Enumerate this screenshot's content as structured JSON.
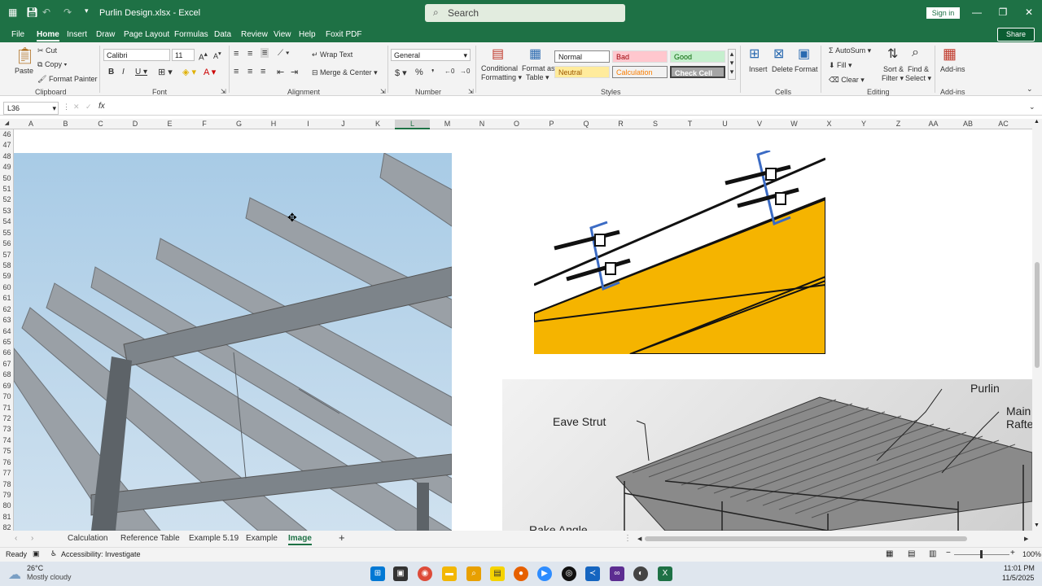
{
  "app": {
    "file_name": "Purlin Design.xlsx  -  Excel",
    "search_placeholder": "Search",
    "sign_in": "Sign in"
  },
  "menu": {
    "tabs": [
      "File",
      "Home",
      "Insert",
      "Draw",
      "Page Layout",
      "Formulas",
      "Data",
      "Review",
      "View",
      "Help",
      "Foxit PDF"
    ],
    "share": "Share"
  },
  "ribbon": {
    "clipboard": {
      "paste": "Paste",
      "cut": "Cut",
      "copy": "Copy",
      "format_painter": "Format Painter",
      "label": "Clipboard"
    },
    "font": {
      "name": "Calibri",
      "size": "11",
      "label": "Font"
    },
    "alignment": {
      "wrap_text": "Wrap Text",
      "merge_center": "Merge & Center",
      "label": "Alignment"
    },
    "number": {
      "format": "General",
      "label": "Number"
    },
    "styles": {
      "conditional": "Conditional",
      "conditional2": "Formatting",
      "format_as": "Format as",
      "format_as2": "Table",
      "normal": "Normal",
      "bad": "Bad",
      "good": "Good",
      "neutral": "Neutral",
      "calculation": "Calculation",
      "check_cell": "Check Cell",
      "label": "Styles"
    },
    "cells": {
      "insert": "Insert",
      "delete": "Delete",
      "format": "Format",
      "label": "Cells"
    },
    "editing": {
      "autosum": "AutoSum",
      "fill": "Fill",
      "clear": "Clear",
      "sort": "Sort &",
      "sort2": "Filter",
      "find": "Find &",
      "find2": "Select",
      "label": "Editing"
    },
    "addins": {
      "addins": "Add-ins",
      "label": "Add-ins"
    }
  },
  "formula_bar": {
    "name_box": "L36",
    "fx": "fx",
    "value": ""
  },
  "columns": [
    "A",
    "B",
    "C",
    "D",
    "E",
    "F",
    "G",
    "H",
    "I",
    "J",
    "K",
    "L",
    "M",
    "N",
    "O",
    "P",
    "Q",
    "R",
    "S",
    "T",
    "U",
    "V",
    "W",
    "X",
    "Y",
    "Z",
    "AA",
    "AB",
    "AC"
  ],
  "rows": [
    "46",
    "47",
    "48",
    "49",
    "50",
    "51",
    "52",
    "53",
    "54",
    "55",
    "56",
    "57",
    "58",
    "59",
    "60",
    "61",
    "62",
    "63",
    "64",
    "65",
    "66",
    "67",
    "68",
    "69",
    "70",
    "71",
    "72",
    "73",
    "74",
    "75",
    "76",
    "77",
    "78",
    "79",
    "80",
    "81",
    "82"
  ],
  "diagram": {
    "purlin": "Purlin",
    "main_rafter": "Main",
    "main_rafter2": "Rafte",
    "eave_strut": "Eave Strut",
    "rake_angle": "Rake Angle"
  },
  "sheets": [
    "Calculation",
    "Reference Table",
    "Example 5.19",
    "Example",
    "Image"
  ],
  "active_sheet": "Image",
  "status": {
    "ready": "Ready",
    "accessibility": "Accessibility: Investigate",
    "zoom": "100%"
  },
  "taskbar": {
    "temp": "26°C",
    "weather": "Mostly cloudy",
    "time": "11:01 PM",
    "date": "11/5/2025"
  },
  "colors": {
    "excel_green": "#1e7145",
    "sky": "#a9cde8",
    "beam": "#f5b400"
  }
}
